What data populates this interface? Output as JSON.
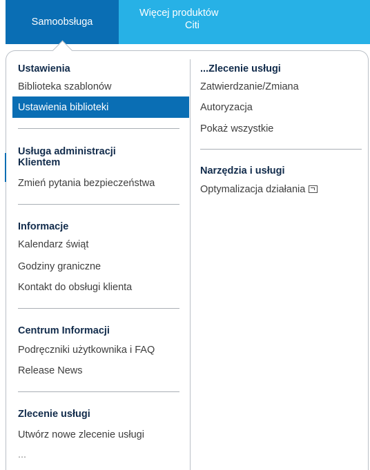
{
  "top_tabs": {
    "self_service": "Samoobsługa",
    "more_products_line1": "Więcej produktów",
    "more_products_line2": "Citi"
  },
  "left_column": {
    "settings": {
      "heading": "Ustawienia",
      "items": [
        "Biblioteka szablonów",
        "Ustawienia biblioteki"
      ]
    },
    "client_admin": {
      "heading_line1": "Usługa administracji",
      "heading_line2": "Klientem",
      "items": [
        "Zmień pytania bezpieczeństwa"
      ]
    },
    "info": {
      "heading": "Informacje",
      "items": [
        "Kalendarz świąt",
        "Godziny graniczne",
        "Kontakt do obsługi klienta"
      ]
    },
    "info_center": {
      "heading": "Centrum Informacji",
      "items": [
        "Podręczniki użytkownika i FAQ",
        "Release News"
      ]
    },
    "service_order": {
      "heading": "Zlecenie usługi",
      "items": [
        "Utwórz nowe zlecenie usługi",
        "..."
      ]
    }
  },
  "right_column": {
    "service_order_more": {
      "heading": "...Zlecenie usługi",
      "items": [
        "Zatwierdzanie/Zmiana",
        "Autoryzacja",
        "Pokaż wszystkie"
      ]
    },
    "tools": {
      "heading": "Narzędzia i usługi",
      "items": [
        "Optymalizacja działania"
      ]
    }
  },
  "icons": {
    "external_link": "external-window-icon"
  },
  "colors": {
    "primary_blue": "#0a6eb4",
    "light_blue": "#27b1e6",
    "heading_navy": "#112b4b"
  }
}
